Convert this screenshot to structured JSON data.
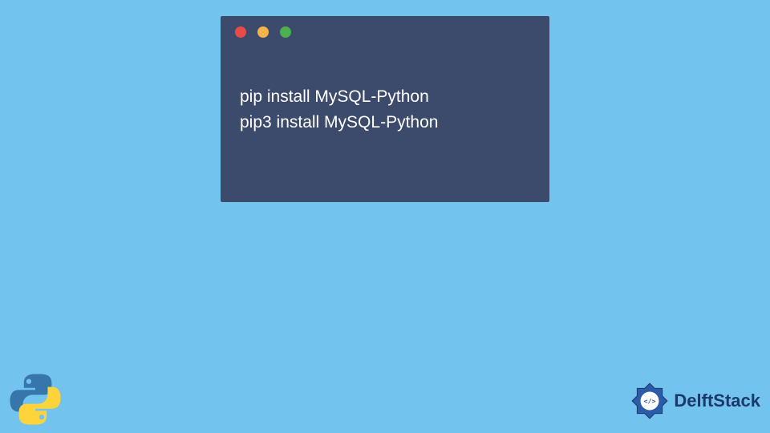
{
  "terminal": {
    "colors": {
      "red": "#e94b4b",
      "yellow": "#f2b54a",
      "green": "#4caf50"
    },
    "lines": [
      "pip install MySQL-Python",
      "pip3 install MySQL-Python"
    ]
  },
  "brand": {
    "name": "DelftStack"
  }
}
